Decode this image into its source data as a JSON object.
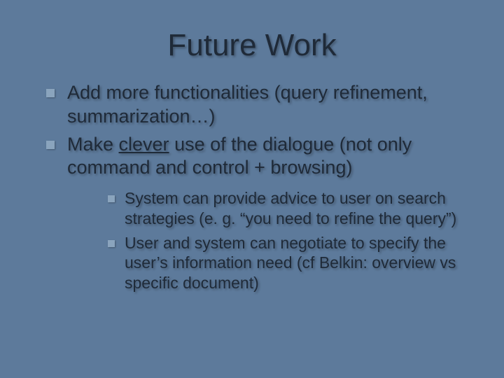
{
  "slide": {
    "title": "Future Work",
    "bullets": [
      {
        "text": "Add more functionalities (query refinement, summarization…)"
      },
      {
        "text_pre": "Make ",
        "text_em": "clever",
        "text_post": " use of the dialogue (not only command and control + browsing)",
        "sub": [
          "System can provide advice to user on search strategies (e. g. “you need to refine the query”)",
          "User and system can negotiate to specify the user’s information need (cf Belkin: overview vs specific document)"
        ]
      }
    ]
  }
}
